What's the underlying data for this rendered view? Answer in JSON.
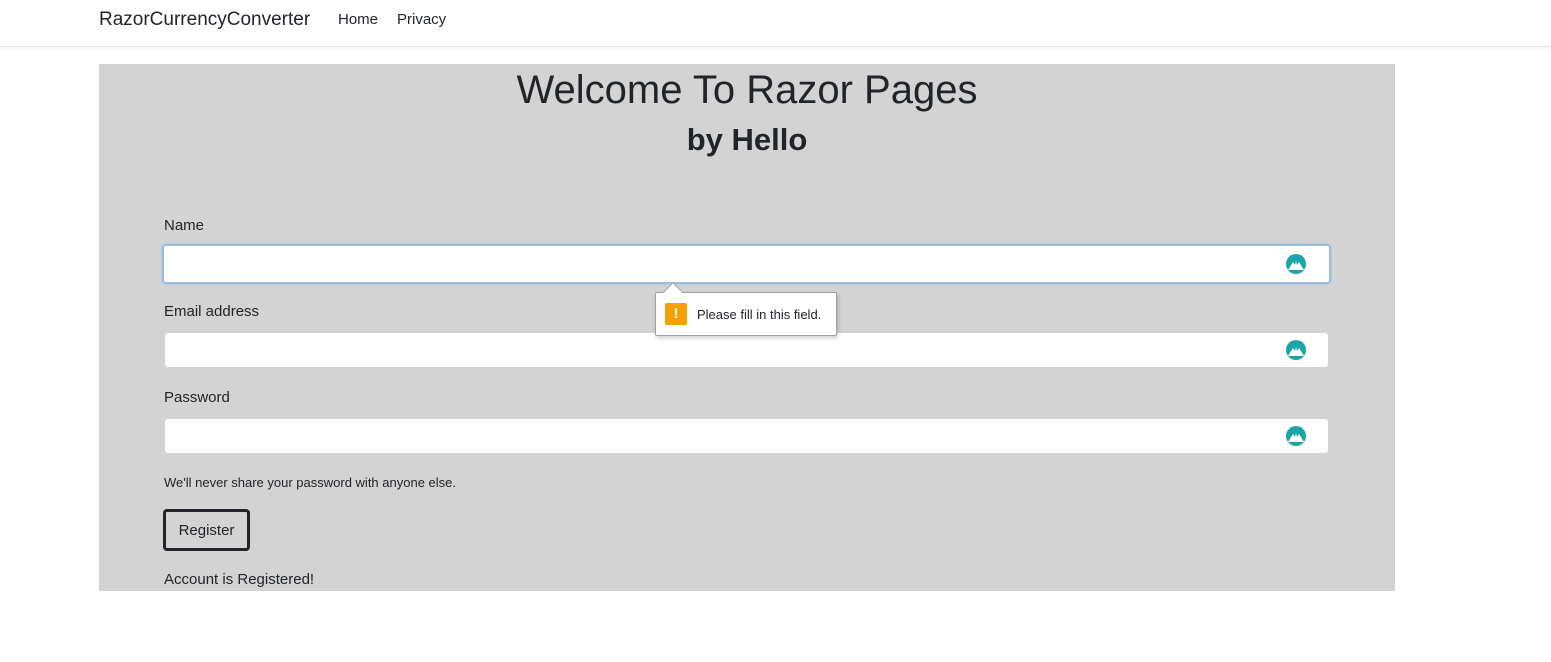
{
  "nav": {
    "brand": "RazorCurrencyConverter",
    "links": [
      "Home",
      "Privacy"
    ]
  },
  "hero": {
    "title": "Welcome To Razor Pages",
    "subtitle": "by Hello"
  },
  "form": {
    "name_label": "Name",
    "name_value": "",
    "email_label": "Email address",
    "email_value": "",
    "password_label": "Password",
    "password_value": "",
    "password_help": "We'll never share your password with anyone else.",
    "submit_label": "Register",
    "status_text": "Account is Registered!"
  },
  "validation_tooltip": {
    "icon_text": "!",
    "message": "Please fill in this field."
  },
  "icons": {
    "field_icon": "vpn-extension-icon",
    "warning_icon": "warning-icon"
  },
  "colors": {
    "panel_bg": "#d3d3d3",
    "field_icon": "#1aa6a6",
    "warning": "#f5a200",
    "focus_border": "#9fbbe0"
  }
}
